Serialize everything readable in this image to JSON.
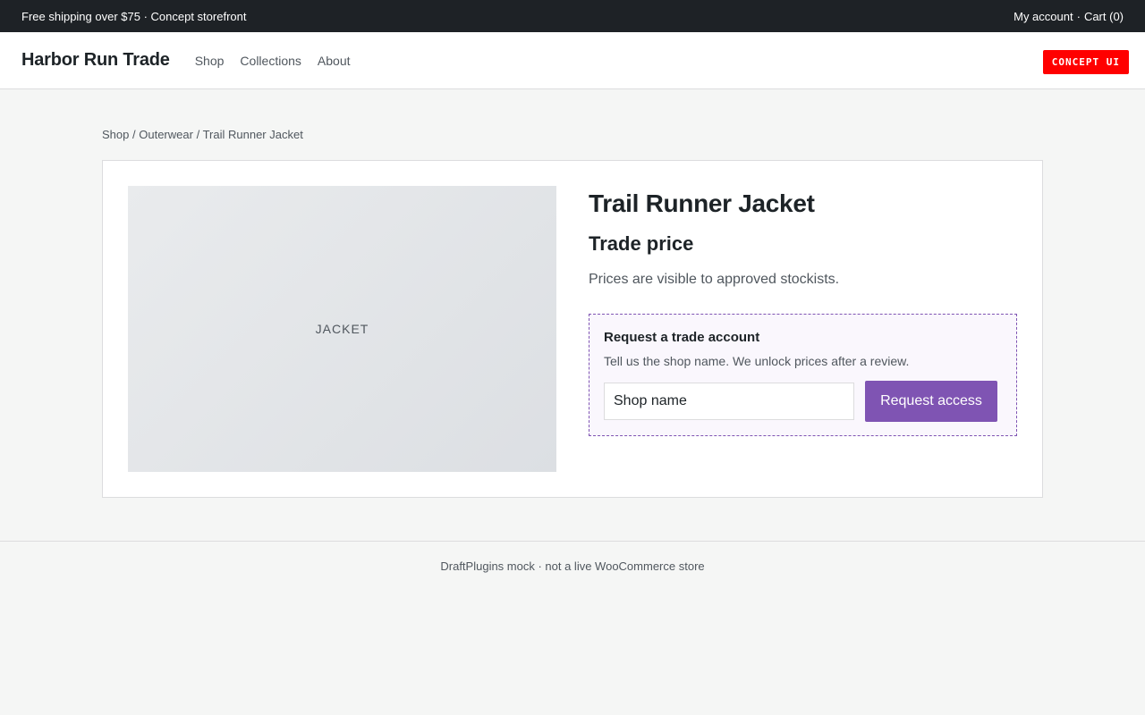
{
  "topbar": {
    "promo": "Free shipping over $75 · Concept storefront",
    "account_label": "My account",
    "separator": "·",
    "cart_label": "Cart (0)"
  },
  "header": {
    "brand": "Harbor Run Trade",
    "nav": [
      {
        "label": "Shop"
      },
      {
        "label": "Collections"
      },
      {
        "label": "About"
      }
    ],
    "badge": "CONCEPT UI"
  },
  "breadcrumb": {
    "items": [
      "Shop",
      "Outerwear",
      "Trail Runner Jacket"
    ],
    "separator": "/"
  },
  "product": {
    "image_label": "JACKET",
    "title": "Trail Runner Jacket",
    "price_heading": "Trade price",
    "price_note": "Prices are visible to approved stockists."
  },
  "trade_request": {
    "title": "Request a trade account",
    "description": "Tell us the shop name. We unlock prices after a review.",
    "input_placeholder": "Shop name",
    "button_label": "Request access"
  },
  "footer": {
    "text": "DraftPlugins mock · not a live WooCommerce store"
  },
  "colors": {
    "accent": "#7f54b3",
    "badge": "#ff0000",
    "topbar": "#1e2226"
  }
}
